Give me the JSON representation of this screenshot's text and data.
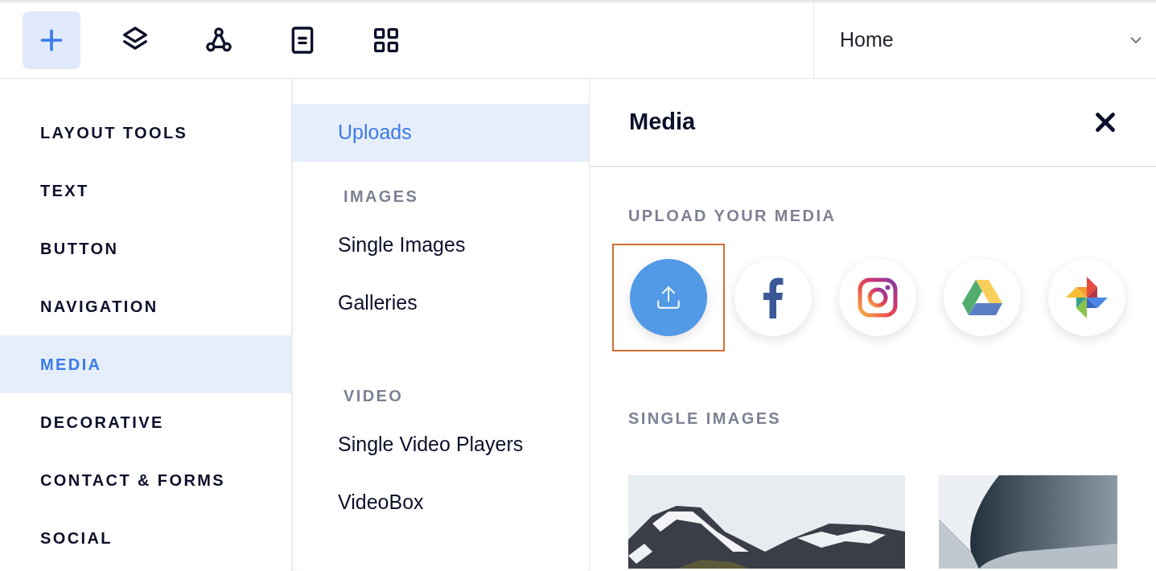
{
  "toolbar": [
    {
      "kind": "add",
      "selected": true
    },
    {
      "kind": "layers",
      "selected": false
    },
    {
      "kind": "connections",
      "selected": false
    },
    {
      "kind": "page",
      "selected": false
    },
    {
      "kind": "apps",
      "selected": false
    }
  ],
  "page_selector": {
    "value": "Home"
  },
  "categories": [
    {
      "label": "LAYOUT TOOLS",
      "selected": false
    },
    {
      "label": "TEXT",
      "selected": false
    },
    {
      "label": "BUTTON",
      "selected": false
    },
    {
      "label": "NAVIGATION",
      "selected": false
    },
    {
      "label": "MEDIA",
      "selected": true
    },
    {
      "label": "DECORATIVE",
      "selected": false
    },
    {
      "label": "CONTACT & FORMS",
      "selected": false
    },
    {
      "label": "SOCIAL",
      "selected": false
    }
  ],
  "subcategories": [
    {
      "kind": "item",
      "label": "Uploads",
      "selected": true
    },
    {
      "kind": "heading",
      "label": "IMAGES"
    },
    {
      "kind": "item",
      "label": "Single Images",
      "selected": false
    },
    {
      "kind": "item",
      "label": "Galleries",
      "selected": false
    },
    {
      "kind": "heading",
      "label": "VIDEO"
    },
    {
      "kind": "item",
      "label": "Single Video Players",
      "selected": false
    },
    {
      "kind": "item",
      "label": "VideoBox",
      "selected": false
    }
  ],
  "panel": {
    "title": "Media",
    "upload_section": {
      "heading": "UPLOAD YOUR MEDIA",
      "sources": [
        {
          "kind": "upload",
          "selected": true
        },
        {
          "kind": "facebook",
          "selected": false
        },
        {
          "kind": "instagram",
          "selected": false
        },
        {
          "kind": "drive",
          "selected": false
        },
        {
          "kind": "photos",
          "selected": false
        }
      ]
    },
    "images_section": {
      "heading": "SINGLE IMAGES"
    }
  }
}
